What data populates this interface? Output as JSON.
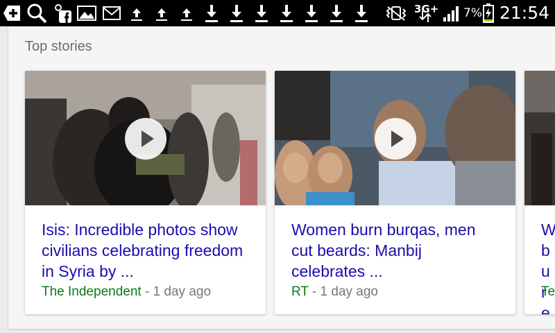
{
  "status_bar": {
    "network": "3G+",
    "battery_percent": "7%",
    "time": "21:54",
    "left_icons": [
      "plus-icon",
      "search-icon",
      "facebook-icon",
      "image-icon",
      "mail-icon",
      "upload-icon",
      "upload-icon",
      "upload-icon",
      "download-icon",
      "download-icon",
      "download-icon",
      "download-icon",
      "download-icon",
      "download-icon",
      "download-icon"
    ],
    "right_icons": [
      "vibrate-icon",
      "network-arrows-icon",
      "signal-icon",
      "battery-charging-icon"
    ]
  },
  "top_stories": {
    "title": "Top stories",
    "stories": [
      {
        "headline": "Isis: Incredible photos show civilians celebrating freedom in Syria by ...",
        "source": "The Independent",
        "separator": " - ",
        "time": "1 day ago",
        "has_video": true
      },
      {
        "headline": "Women burn burqas, men cut beards: Manbij celebrates ...",
        "source": "RT",
        "separator": " - ",
        "time": "1 day ago",
        "has_video": true
      },
      {
        "headline": "W bu re",
        "source": "Te",
        "separator": "",
        "time": "",
        "has_video": false
      }
    ]
  },
  "colors": {
    "headline": "#1a0dab",
    "source": "#0a7a1a",
    "meta": "#777777",
    "status_bar": "#000000",
    "battery_low": "#9be000"
  }
}
